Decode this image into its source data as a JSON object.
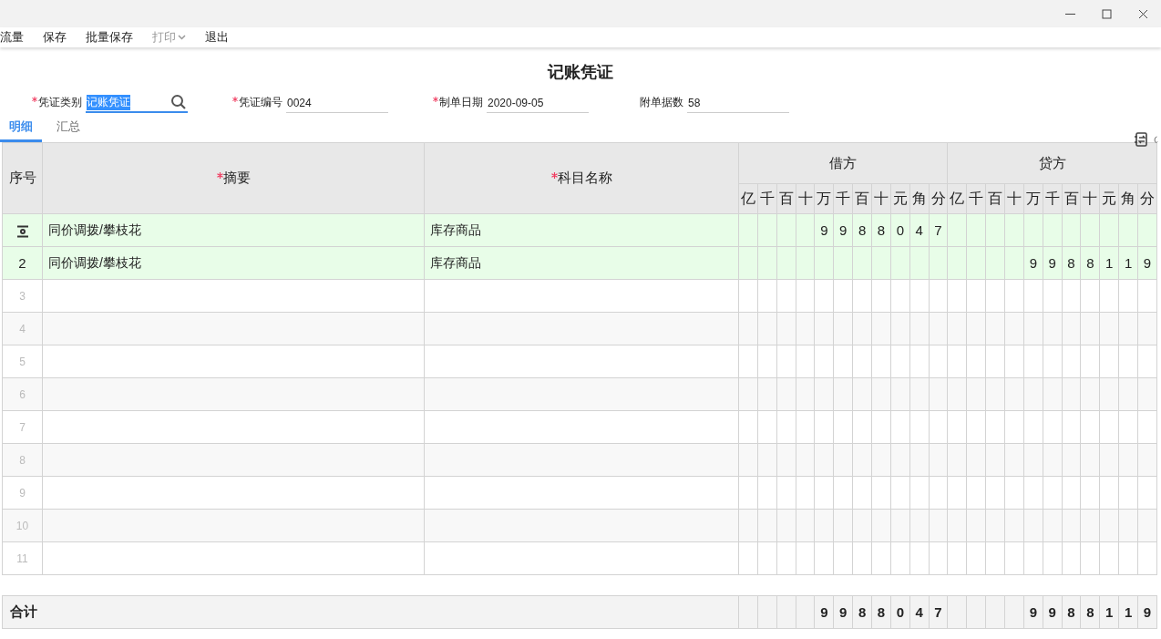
{
  "toolbar": [
    {
      "label": "流量",
      "disabled": false,
      "dropdown": false
    },
    {
      "label": "保存",
      "disabled": false,
      "dropdown": false
    },
    {
      "label": "批量保存",
      "disabled": false,
      "dropdown": false
    },
    {
      "label": "打印",
      "disabled": true,
      "dropdown": true
    },
    {
      "label": "退出",
      "disabled": false,
      "dropdown": false
    }
  ],
  "title": "记账凭证",
  "fields": [
    {
      "label": "凭证类别",
      "required": true,
      "value": "记账凭证",
      "focused": true,
      "search": true
    },
    {
      "label": "凭证编号",
      "required": true,
      "value": "0024",
      "focused": false,
      "search": false
    },
    {
      "label": "制单日期",
      "required": true,
      "value": "2020-09-05",
      "focused": false,
      "search": false
    },
    {
      "label": "附单据数",
      "required": false,
      "value": "58",
      "focused": false,
      "search": false
    }
  ],
  "tabs": [
    {
      "label": "明细",
      "selected": true
    },
    {
      "label": "汇总",
      "selected": false
    }
  ],
  "table": {
    "columns": [
      {
        "label": "序号",
        "required": false
      },
      {
        "label": "摘要",
        "required": true
      },
      {
        "label": "科目名称",
        "required": true
      }
    ],
    "debit": {
      "label": "借方",
      "units": [
        "亿",
        "千",
        "百",
        "十",
        "万",
        "千",
        "百",
        "十",
        "元",
        "角",
        "分"
      ]
    },
    "credit": {
      "label": "贷方",
      "units": [
        "亿",
        "千",
        "百",
        "十",
        "万",
        "千",
        "百",
        "十",
        "元",
        "角",
        "分"
      ]
    },
    "rows": [
      {
        "kind": "icon",
        "highlighted": true,
        "summary": "同价调拨/攀枝花",
        "subject": "库存商品",
        "debit": [
          "9",
          "9",
          "8",
          "8",
          "0",
          "4",
          "7"
        ]
      },
      {
        "kind": "number",
        "seq": "2",
        "highlighted": true,
        "summary": "同价调拨/攀枝花",
        "subject": "库存商品",
        "credit": [
          "9",
          "9",
          "8",
          "8",
          "1",
          "1",
          "9"
        ]
      },
      {
        "kind": "empty",
        "seq": "3",
        "highlighted": false
      },
      {
        "kind": "empty",
        "seq": "4",
        "highlighted": false
      },
      {
        "kind": "empty",
        "seq": "5",
        "highlighted": false
      },
      {
        "kind": "empty",
        "seq": "6",
        "highlighted": false
      },
      {
        "kind": "empty",
        "seq": "7",
        "highlighted": false
      },
      {
        "kind": "empty",
        "seq": "8",
        "highlighted": false
      },
      {
        "kind": "empty",
        "seq": "9",
        "highlighted": false
      },
      {
        "kind": "empty",
        "seq": "10",
        "highlighted": false
      },
      {
        "kind": "empty",
        "seq": "11",
        "highlighted": false
      }
    ],
    "total": {
      "label": "合计",
      "debit": [
        "9",
        "9",
        "8",
        "8",
        "0",
        "4",
        "7"
      ],
      "credit": [
        "9",
        "9",
        "8",
        "8",
        "1",
        "1",
        "9"
      ]
    }
  }
}
